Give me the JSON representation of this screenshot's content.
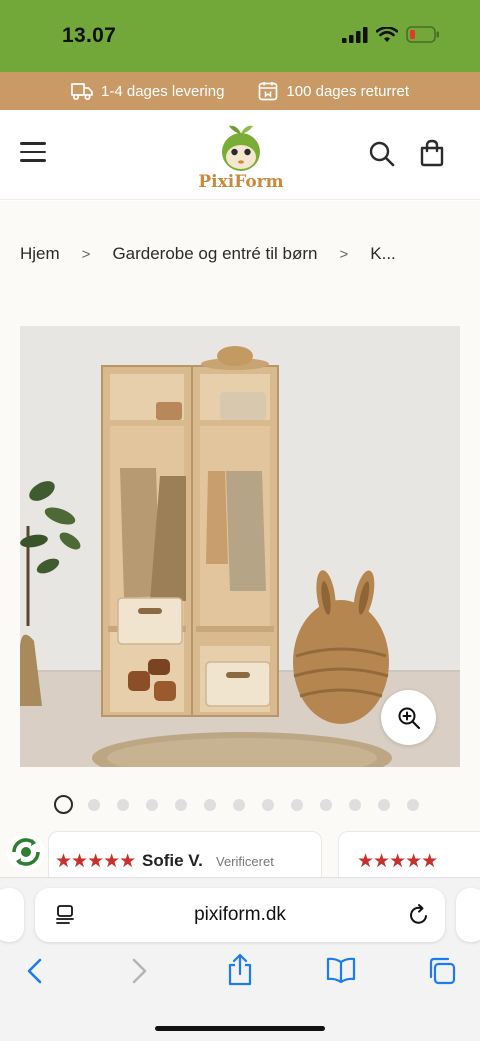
{
  "status_bar": {
    "time": "13.07",
    "battery_color": "#e03a2f"
  },
  "promo": {
    "delivery": {
      "label": "1-4 dages levering",
      "icon": "truck-icon"
    },
    "returns": {
      "label": "100 dages returret",
      "icon": "calendar-icon"
    }
  },
  "header": {
    "logo": {
      "part1": "Pixi",
      "part2": "Form"
    },
    "menu_icon": "hamburger-icon",
    "search_icon": "search-icon",
    "cart_icon": "shopping-bag-icon"
  },
  "breadcrumb": {
    "items": [
      "Hjem",
      "Garderobe og entré til børn",
      "K..."
    ],
    "separator": ">"
  },
  "gallery": {
    "zoom_icon": "zoom-in-icon",
    "dot_count": 13,
    "active_index": 0
  },
  "reviews": [
    {
      "stars": "★★★★★",
      "name": "Sofie V.",
      "verified": "Verificeret"
    },
    {
      "stars": "★★★★★"
    }
  ],
  "browser": {
    "url": "pixiform.dk",
    "icons": [
      "back-icon",
      "forward-icon",
      "share-icon",
      "bookmarks-icon",
      "tabs-icon"
    ]
  },
  "colors": {
    "status_green": "#72a83a",
    "promo_tan": "#c99a66",
    "star_red": "#c9302c",
    "safari_blue": "#1a7cf0"
  }
}
